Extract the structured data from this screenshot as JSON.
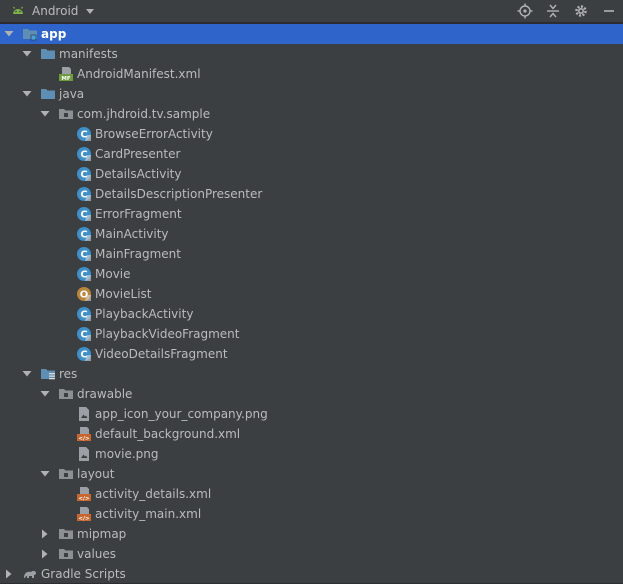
{
  "toolbar": {
    "view_label": "Android",
    "icons": [
      "android-icon",
      "dropdown-icon",
      "locate-icon",
      "collapse-icon",
      "settings-icon",
      "hide-icon"
    ]
  },
  "tree": [
    {
      "label": "app",
      "depth": 0,
      "expanded": true,
      "icon": "module-folder",
      "selected": true
    },
    {
      "label": "manifests",
      "depth": 1,
      "expanded": true,
      "icon": "folder"
    },
    {
      "label": "AndroidManifest.xml",
      "depth": 2,
      "icon": "manifest-file"
    },
    {
      "label": "java",
      "depth": 1,
      "expanded": true,
      "icon": "folder"
    },
    {
      "label": "com.jhdroid.tv.sample",
      "depth": 2,
      "expanded": true,
      "icon": "package"
    },
    {
      "label": "BrowseErrorActivity",
      "depth": 3,
      "icon": "class"
    },
    {
      "label": "CardPresenter",
      "depth": 3,
      "icon": "class"
    },
    {
      "label": "DetailsActivity",
      "depth": 3,
      "icon": "class"
    },
    {
      "label": "DetailsDescriptionPresenter",
      "depth": 3,
      "icon": "class"
    },
    {
      "label": "ErrorFragment",
      "depth": 3,
      "icon": "class"
    },
    {
      "label": "MainActivity",
      "depth": 3,
      "icon": "class"
    },
    {
      "label": "MainFragment",
      "depth": 3,
      "icon": "class"
    },
    {
      "label": "Movie",
      "depth": 3,
      "icon": "class"
    },
    {
      "label": "MovieList",
      "depth": 3,
      "icon": "object"
    },
    {
      "label": "PlaybackActivity",
      "depth": 3,
      "icon": "class"
    },
    {
      "label": "PlaybackVideoFragment",
      "depth": 3,
      "icon": "class"
    },
    {
      "label": "VideoDetailsFragment",
      "depth": 3,
      "icon": "class"
    },
    {
      "label": "res",
      "depth": 1,
      "expanded": true,
      "icon": "res-folder"
    },
    {
      "label": "drawable",
      "depth": 2,
      "expanded": true,
      "icon": "package"
    },
    {
      "label": "app_icon_your_company.png",
      "depth": 3,
      "icon": "image-file"
    },
    {
      "label": "default_background.xml",
      "depth": 3,
      "icon": "xml-file"
    },
    {
      "label": "movie.png",
      "depth": 3,
      "icon": "image-file"
    },
    {
      "label": "layout",
      "depth": 2,
      "expanded": true,
      "icon": "package"
    },
    {
      "label": "activity_details.xml",
      "depth": 3,
      "icon": "xml-file"
    },
    {
      "label": "activity_main.xml",
      "depth": 3,
      "icon": "xml-file"
    },
    {
      "label": "mipmap",
      "depth": 2,
      "expanded": false,
      "icon": "package"
    },
    {
      "label": "values",
      "depth": 2,
      "expanded": false,
      "icon": "package"
    },
    {
      "label": "Gradle Scripts",
      "depth": 0,
      "expanded": false,
      "icon": "gradle"
    }
  ],
  "colors": {
    "selection": "#2f65ca",
    "folder": "#5e8eb4",
    "class": "#3f8fc8",
    "object": "#b9863c",
    "xml": "#c9652e",
    "manifest": "#6f9b3e"
  }
}
